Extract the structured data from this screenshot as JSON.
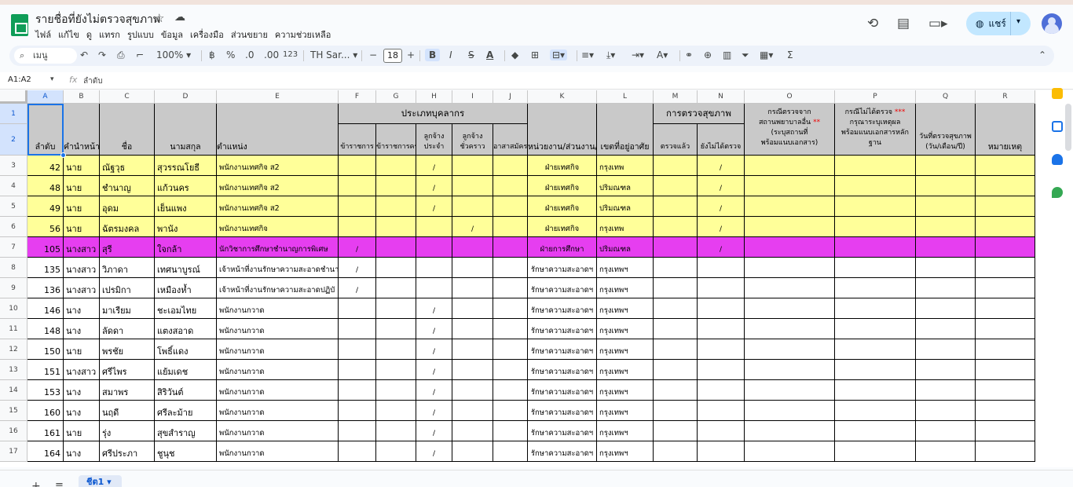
{
  "doc": {
    "title": "รายชื่อที่ยังไม่ตรวจสุขภาพ",
    "menu": [
      "ไฟล์",
      "แก้ไข",
      "ดู",
      "แทรก",
      "รูปแบบ",
      "ข้อมูล",
      "เครื่องมือ",
      "ส่วนขยาย",
      "ความช่วยเหลือ"
    ],
    "share_label": "แชร์"
  },
  "toolbar": {
    "search_label": "เมนู",
    "zoom": "100%",
    "currency": "฿",
    "percent": "%",
    "dec_less": ".0",
    "dec_more": ".00",
    "number_format": "123",
    "font": "TH Sar...",
    "font_size": "18",
    "bold": "B",
    "italic": "I",
    "strike": "S",
    "textcolor": "A"
  },
  "formula": {
    "namebox": "A1:A2",
    "fx": "fx",
    "value": "ลำดับ"
  },
  "columns": [
    "A",
    "B",
    "C",
    "D",
    "E",
    "F",
    "G",
    "H",
    "I",
    "J",
    "K",
    "L",
    "M",
    "N",
    "O",
    "P",
    "Q",
    "R"
  ],
  "row_numbers": [
    "1",
    "2",
    "3",
    "4",
    "5",
    "6",
    "7",
    "8",
    "9",
    "10",
    "11",
    "12",
    "13",
    "14",
    "15",
    "16",
    "17"
  ],
  "header": {
    "group_personnel": "ประเภทบุคลากร",
    "group_health": "การตรวจสุขภาพ",
    "col_a": "ลำดับ",
    "col_b": "คำนำหน้า",
    "col_c": "ชื่อ",
    "col_d": "นามสกุล",
    "col_e": "ตำแหน่ง",
    "col_f": "ข้าราชการ",
    "col_g": "ข้าราชการครู",
    "col_h1": "ลูกจ้าง",
    "col_h2": "ประจำ",
    "col_i1": "ลูกจ้าง",
    "col_i2": "ชั่วคราว",
    "col_j": "อาสาสมัคร",
    "col_k": "หน่วยงาน/ส่วนงาน/ฝ่าย",
    "col_l": "เขตที่อยู่อาศัย",
    "col_m": "ตรวจแล้ว",
    "col_n": "ยังไม่ได้ตรวจ",
    "col_o1": "กรณีตรวจจาก",
    "col_o2": "สถานพยาบาลอื่น",
    "col_o2_mark": "**",
    "col_o3": "(ระบุสถานที่",
    "col_o4": "พร้อมแนบเอกสาร)",
    "col_p1": "กรณีไม่ได้ตรวจ",
    "col_p1_mark": "***",
    "col_p2": "กรุณาระบุเหตุผล",
    "col_p3": "พร้อมแนบเอกสารหลัก",
    "col_p4": "ฐาน",
    "col_q1": "วันที่ตรวจสุขภาพ",
    "col_q2": "(วัน/เดือน/ปี)",
    "col_r": "หมายเหตุ"
  },
  "rows": [
    {
      "no": "42",
      "title": "นาย",
      "first": "ณัฐวุธ",
      "last": "สุวรรณโยธี",
      "pos": "พนักงานเทศกิจ ส2",
      "f": "",
      "h": "/",
      "i": "",
      "k": "ฝ่ายเทศกิจ",
      "l": "กรุงเทพ",
      "m": "",
      "n": "/",
      "color": "yellow"
    },
    {
      "no": "48",
      "title": "นาย",
      "first": "ชำนาญ",
      "last": "แก้วนคร",
      "pos": "พนักงานเทศกิจ ส2",
      "f": "",
      "h": "/",
      "i": "",
      "k": "ฝ่ายเทศกิจ",
      "l": "ปริมณฑล",
      "m": "",
      "n": "/",
      "color": "yellow"
    },
    {
      "no": "49",
      "title": "นาย",
      "first": "อุดม",
      "last": "เย็นแพง",
      "pos": "พนักงานเทศกิจ ส2",
      "f": "",
      "h": "/",
      "i": "",
      "k": "ฝ่ายเทศกิจ",
      "l": "ปริมณฑล",
      "m": "",
      "n": "/",
      "color": "yellow"
    },
    {
      "no": "56",
      "title": "นาย",
      "first": "ฉัตรมงคล",
      "last": "พานัง",
      "pos": "พนักงานเทศกิจ",
      "f": "",
      "h": "",
      "i": "/",
      "k": "ฝ่ายเทศกิจ",
      "l": "กรุงเทพ",
      "m": "",
      "n": "/",
      "color": "yellow"
    },
    {
      "no": "105",
      "title": "นางสาว",
      "first": "สุรี",
      "last": "ใจกล้า",
      "pos": "นักวิชาการศึกษาชำนาญการพิเศษ",
      "f": "/",
      "h": "",
      "i": "",
      "k": "ฝ่ายการศึกษา",
      "l": "ปริมณฑล",
      "m": "",
      "n": "/",
      "color": "magenta"
    },
    {
      "no": "135",
      "title": "นางสาว",
      "first": "วิภาดา",
      "last": "เทศนาบูรณ์",
      "pos": "เจ้าหน้าที่งานรักษาความสะอาดชำนาญ",
      "f": "/",
      "h": "",
      "i": "",
      "k": "รักษาความสะอาดฯ",
      "l": "กรุงเทพฯ",
      "m": "",
      "n": "",
      "color": "white"
    },
    {
      "no": "136",
      "title": "นางสาว",
      "first": "เปรมิกา",
      "last": "เหมืองห้ำ",
      "pos": "เจ้าหน้าที่งานรักษาความสะอาดปฏิบั",
      "f": "/",
      "h": "",
      "i": "",
      "k": "รักษาความสะอาดฯ",
      "l": "กรุงเทพฯ",
      "m": "",
      "n": "",
      "color": "white"
    },
    {
      "no": "146",
      "title": "นาง",
      "first": "มาเรียม",
      "last": "ชะเอมไทย",
      "pos": "พนักงานกวาด",
      "f": "",
      "h": "/",
      "i": "",
      "k": "รักษาความสะอาดฯ",
      "l": "กรุงเทพฯ",
      "m": "",
      "n": "",
      "color": "white"
    },
    {
      "no": "148",
      "title": "นาง",
      "first": "ลัดดา",
      "last": "แตงสอาด",
      "pos": "พนักงานกวาด",
      "f": "",
      "h": "/",
      "i": "",
      "k": "รักษาความสะอาดฯ",
      "l": "กรุงเทพฯ",
      "m": "",
      "n": "",
      "color": "white"
    },
    {
      "no": "150",
      "title": "นาย",
      "first": "พรชัย",
      "last": "โพธิ์แดง",
      "pos": "พนักงานกวาด",
      "f": "",
      "h": "/",
      "i": "",
      "k": "รักษาความสะอาดฯ",
      "l": "กรุงเทพฯ",
      "m": "",
      "n": "",
      "color": "white"
    },
    {
      "no": "151",
      "title": "นางสาว",
      "first": "ศรีไพร",
      "last": "แย้มเดช",
      "pos": "พนักงานกวาด",
      "f": "",
      "h": "/",
      "i": "",
      "k": "รักษาความสะอาดฯ",
      "l": "กรุงเทพฯ",
      "m": "",
      "n": "",
      "color": "white"
    },
    {
      "no": "153",
      "title": "นาง",
      "first": "สมาพร",
      "last": "สิริวันต์",
      "pos": "พนักงานกวาด",
      "f": "",
      "h": "/",
      "i": "",
      "k": "รักษาความสะอาดฯ",
      "l": "กรุงเทพฯ",
      "m": "",
      "n": "",
      "color": "white"
    },
    {
      "no": "160",
      "title": "นาง",
      "first": "นฤดี",
      "last": "ศรีละม้าย",
      "pos": "พนักงานกวาด",
      "f": "",
      "h": "/",
      "i": "",
      "k": "รักษาความสะอาดฯ",
      "l": "กรุงเทพฯ",
      "m": "",
      "n": "",
      "color": "white"
    },
    {
      "no": "161",
      "title": "นาย",
      "first": "รุ่ง",
      "last": "สุขสำราญ",
      "pos": "พนักงานกวาด",
      "f": "",
      "h": "/",
      "i": "",
      "k": "รักษาความสะอาดฯ",
      "l": "กรุงเทพฯ",
      "m": "",
      "n": "",
      "color": "white"
    },
    {
      "no": "164",
      "title": "นาง",
      "first": "ศรีประภา",
      "last": "ชูนุช",
      "pos": "พนักงานกวาด",
      "f": "",
      "h": "/",
      "i": "",
      "k": "รักษาความสะอาดฯ",
      "l": "กรุงเทพฯ",
      "m": "",
      "n": "",
      "color": "white"
    }
  ],
  "row_colors": {
    "yellow": "#ffff99",
    "magenta": "#e63ef0",
    "white": "#ffffff",
    "header": "#c9c9c9"
  },
  "sheet": {
    "tab_label": "ชีต1"
  }
}
